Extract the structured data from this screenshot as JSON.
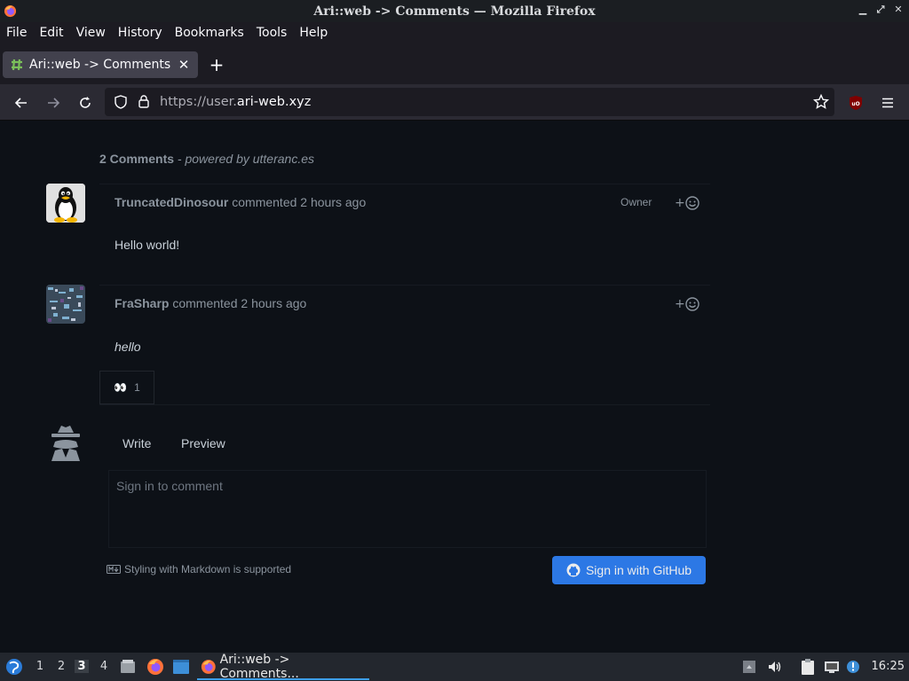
{
  "window": {
    "title": "Ari::web -> Comments — Mozilla Firefox",
    "controls": [
      "minimize",
      "maximize",
      "close"
    ]
  },
  "menu": {
    "items": [
      "File",
      "Edit",
      "View",
      "History",
      "Bookmarks",
      "Tools",
      "Help"
    ]
  },
  "tabs": [
    {
      "label": "Ari::web -> Comments",
      "active": true,
      "icon": "tab-favicon-icon"
    }
  ],
  "nav": {
    "url_prefix": "https://user.",
    "url_domain": "ari-web.xyz"
  },
  "comments_section": {
    "count_label": "2 Comments",
    "powered_by": "- powered by utteranc.es",
    "comments": [
      {
        "author": "TruncatedDinosour",
        "action": "commented 2 hours ago",
        "role": "Owner",
        "body": "Hello world!",
        "avatar": "tux-avatar"
      },
      {
        "author": "FraSharp",
        "action": "commented 2 hours ago",
        "body": "hello",
        "avatar": "pixel-noise-avatar",
        "reactions": [
          {
            "emoji": "👀",
            "count": "1"
          }
        ]
      }
    ],
    "editor": {
      "tab_write": "Write",
      "tab_preview": "Preview",
      "placeholder": "Sign in to comment",
      "markdown_note": "Styling with Markdown is supported",
      "signin_label": "Sign in with GitHub"
    }
  },
  "taskbar": {
    "workspaces": [
      "1",
      "2",
      "3",
      "4"
    ],
    "active_workspace": "3",
    "window_label": "Ari::web -> Comments...",
    "clock": "16:25"
  },
  "colors": {
    "page_bg": "#0d1117",
    "accent": "#2f81f7",
    "text_muted": "#8b949e",
    "text_primary": "#c9d1d9"
  }
}
